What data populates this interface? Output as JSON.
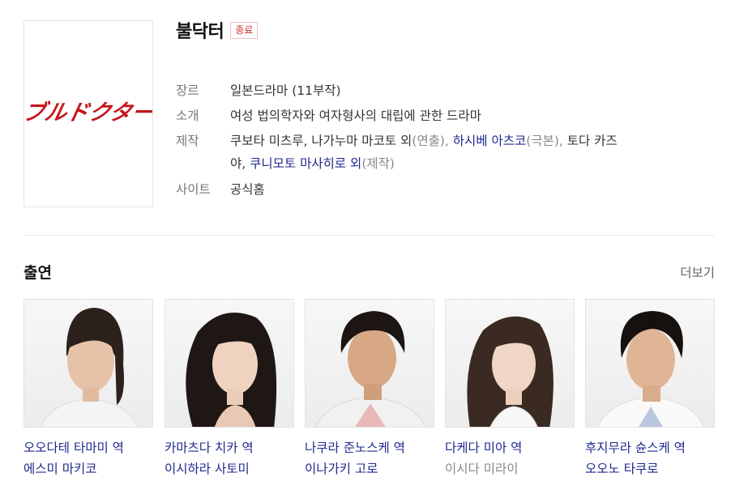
{
  "drama": {
    "title": "불닥터",
    "status_badge": "종료",
    "genre_label": "장르",
    "genre_value": "일본드라마 (11부작)",
    "intro_label": "소개",
    "intro_value": "여성 법의학자와 여자형사의 대립에 관한 드라마",
    "production_label": "제작",
    "production": {
      "part1": "쿠보타 미츠루, 나가누마 마코토 외",
      "part1_role": "(연출), ",
      "part2": "하시베 아츠코",
      "part2_role": "(극본), ",
      "part3a": "토다 카즈",
      "part3b": "야, ",
      "part4": "쿠니모토 마사히로 외",
      "part4_role": "(제작)"
    },
    "site_label": "사이트",
    "site_value": "공식홈",
    "poster_text": "ブルドクター"
  },
  "cast_section": {
    "title": "출연",
    "more_label": "더보기"
  },
  "cast": [
    {
      "role": "오오다테 타마미 역",
      "actor": "에스미 마키코",
      "actor_linked": true
    },
    {
      "role": "카마츠다 치카 역",
      "actor": "이시하라 사토미",
      "actor_linked": true
    },
    {
      "role": "나쿠라 준노스케 역",
      "actor": "이나가키 고로",
      "actor_linked": true
    },
    {
      "role": "다케다 미아 역",
      "actor": "이시다 미라이",
      "actor_linked": false
    },
    {
      "role": "후지무라 슌스케 역",
      "actor": "오오노 타쿠로",
      "actor_linked": true
    }
  ],
  "colors": {
    "link": "#1f2a8e",
    "badge_red": "#c5392f",
    "poster_red": "#c4161c",
    "label_gray": "#777777"
  }
}
